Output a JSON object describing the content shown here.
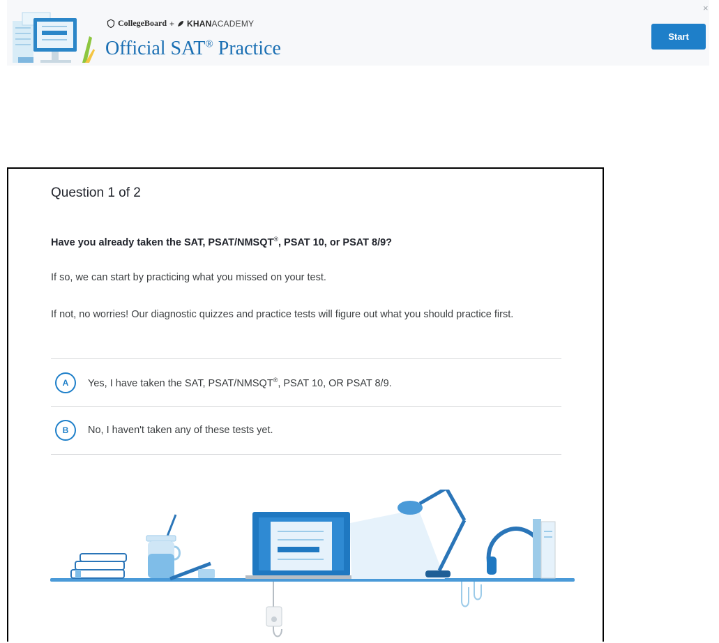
{
  "banner": {
    "brand_college_board": "CollegeBoard",
    "brand_plus": "+",
    "brand_khan": "KHAN",
    "brand_academy": "ACADEMY",
    "title": "Official SAT",
    "title_reg": "®",
    "title_suffix": " Practice",
    "start_label": "Start",
    "close_label": "×"
  },
  "quiz": {
    "question_count": "Question 1 of 2",
    "question_main": "Have you already taken the SAT, PSAT/NMSQT",
    "question_reg": "®",
    "question_rest": ", PSAT 10, or PSAT 8/9?",
    "paragraph_1": "If so, we can start by practicing what you missed on your test.",
    "paragraph_2": "If not, no worries! Our diagnostic quizzes and practice tests will figure out what you should practice first.",
    "choices": [
      {
        "letter": "A",
        "text_pre": "Yes, I have taken the SAT, PSAT/NMSQT",
        "text_reg": "®",
        "text_post": ", PSAT 10, OR PSAT 8/9."
      },
      {
        "letter": "B",
        "text": "No, I haven't taken any of these tests yet."
      }
    ]
  },
  "colors": {
    "brand_blue": "#1e7fc9",
    "title_blue": "#1a6fb3",
    "banner_bg": "#f7f8fa",
    "divider": "#d6d8da"
  },
  "icons": [
    "collegeboard-acorn-icon",
    "khan-leaf-icon",
    "close-icon",
    "desk-illustration",
    "banner-illustration"
  ]
}
